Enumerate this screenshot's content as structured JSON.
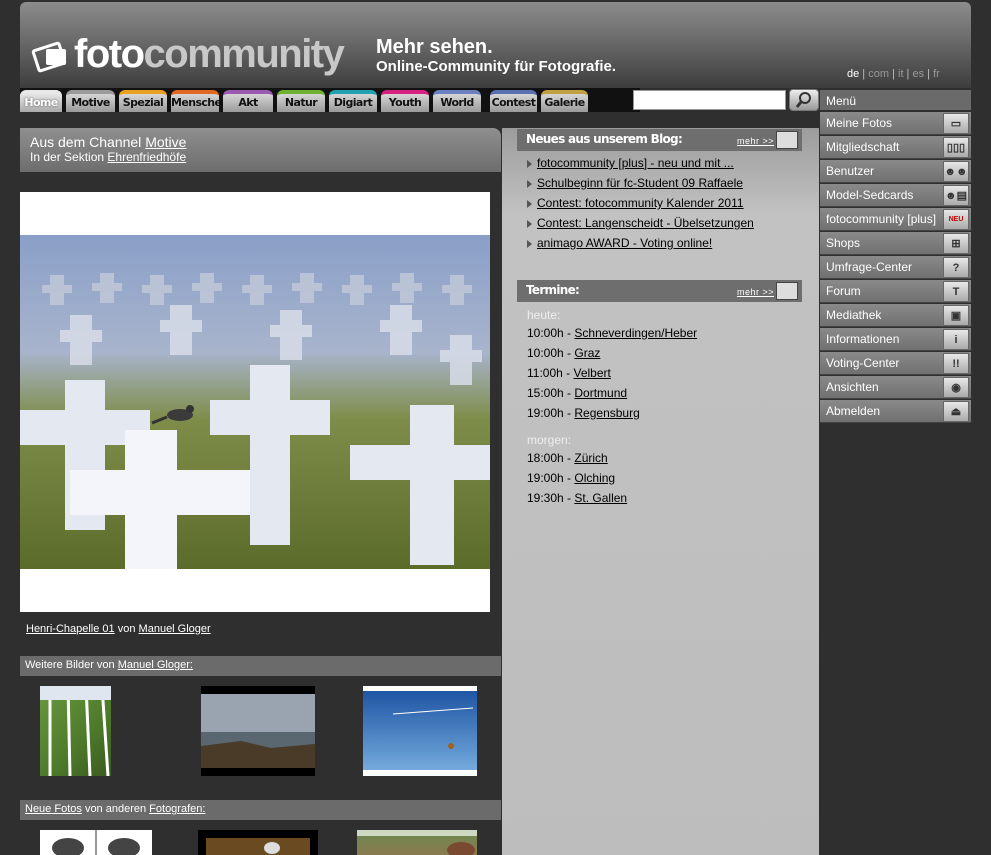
{
  "header": {
    "logo_text_1": "foto",
    "logo_text_2": "community",
    "slogan_1": "Mehr sehen.",
    "slogan_2": "Online-Community für Fotografie.",
    "languages": [
      "de",
      "com",
      "it",
      "es",
      "fr"
    ],
    "active_language": "de"
  },
  "tabs": [
    {
      "label": "Home",
      "color": "#e8e8e8"
    },
    {
      "label": "Motive",
      "color": "#9a9a9a"
    },
    {
      "label": "Spezial",
      "color": "#e8a020"
    },
    {
      "label": "Menschen",
      "color": "#e06820"
    },
    {
      "label": "Akt",
      "color": "#9a5ab0"
    },
    {
      "label": "Natur",
      "color": "#70b030"
    },
    {
      "label": "Digiart",
      "color": "#20a0b0"
    },
    {
      "label": "Youth",
      "color": "#d82080"
    },
    {
      "label": "World",
      "color": "#6a80c0"
    },
    {
      "label": "Contest",
      "color": "#5a70b0"
    },
    {
      "label": "Galerie",
      "color": "#c0a040"
    }
  ],
  "channel": {
    "prefix": "Aus dem Channel",
    "name": "Motive",
    "section_prefix": "In der Sektion",
    "section": "Ehrenfriedhöfe"
  },
  "photo": {
    "title": "Henri-Chapelle 01",
    "by": "von",
    "author": "Manuel Gloger"
  },
  "more_images": {
    "prefix": "Weitere Bilder von",
    "author": "Manuel Gloger:"
  },
  "new_photos": {
    "link1": "Neue Fotos",
    "middle": "von anderen",
    "link2": "Fotografen:"
  },
  "blog": {
    "title": "Neues aus unserem Blog:",
    "more": "mehr >>",
    "items": [
      "fotocommunity [plus] - neu und mit ...",
      "Schulbeginn für fc-Student 09 Raffaele",
      "Contest: fotocommunity Kalender 2011",
      "Contest: Langenscheidt - Übelsetzungen",
      "animago AWARD - Voting online!"
    ]
  },
  "termine": {
    "title": "Termine:",
    "more": "mehr >>",
    "today_label": "heute:",
    "today": [
      {
        "time": "10:00h -",
        "place": "Schneverdingen/Heber"
      },
      {
        "time": "10:00h -",
        "place": "Graz"
      },
      {
        "time": "11:00h -",
        "place": "Velbert"
      },
      {
        "time": "15:00h -",
        "place": "Dortmund"
      },
      {
        "time": "19:00h -",
        "place": "Regensburg"
      }
    ],
    "tomorrow_label": "morgen:",
    "tomorrow": [
      {
        "time": "18:00h -",
        "place": "Zürich"
      },
      {
        "time": "19:00h -",
        "place": "Olching"
      },
      {
        "time": "19:30h -",
        "place": "St. Gallen"
      }
    ]
  },
  "menu": {
    "title": "Menü",
    "items": [
      {
        "label": "Meine Fotos",
        "icon": "photos-icon",
        "glyph": "▭"
      },
      {
        "label": "Mitgliedschaft",
        "icon": "membership-icon",
        "glyph": "▯▯▯"
      },
      {
        "label": "Benutzer",
        "icon": "users-icon",
        "glyph": "☻☻"
      },
      {
        "label": "Model-Sedcards",
        "icon": "sedcard-icon",
        "glyph": "☻▤"
      },
      {
        "label": "fotocommunity [plus]",
        "icon": "plus-new-icon",
        "glyph": "NEU"
      },
      {
        "label": "Shops",
        "icon": "cart-icon",
        "glyph": "⊞"
      },
      {
        "label": "Umfrage-Center",
        "icon": "question-icon",
        "glyph": "?"
      },
      {
        "label": "Forum",
        "icon": "forum-icon",
        "glyph": "T"
      },
      {
        "label": "Mediathek",
        "icon": "media-icon",
        "glyph": "▣"
      },
      {
        "label": "Informationen",
        "icon": "info-icon",
        "glyph": "i"
      },
      {
        "label": "Voting-Center",
        "icon": "voting-icon",
        "glyph": "!!"
      },
      {
        "label": "Ansichten",
        "icon": "eye-icon",
        "glyph": "◉"
      },
      {
        "label": "Abmelden",
        "icon": "logout-icon",
        "glyph": "⏏"
      }
    ]
  }
}
